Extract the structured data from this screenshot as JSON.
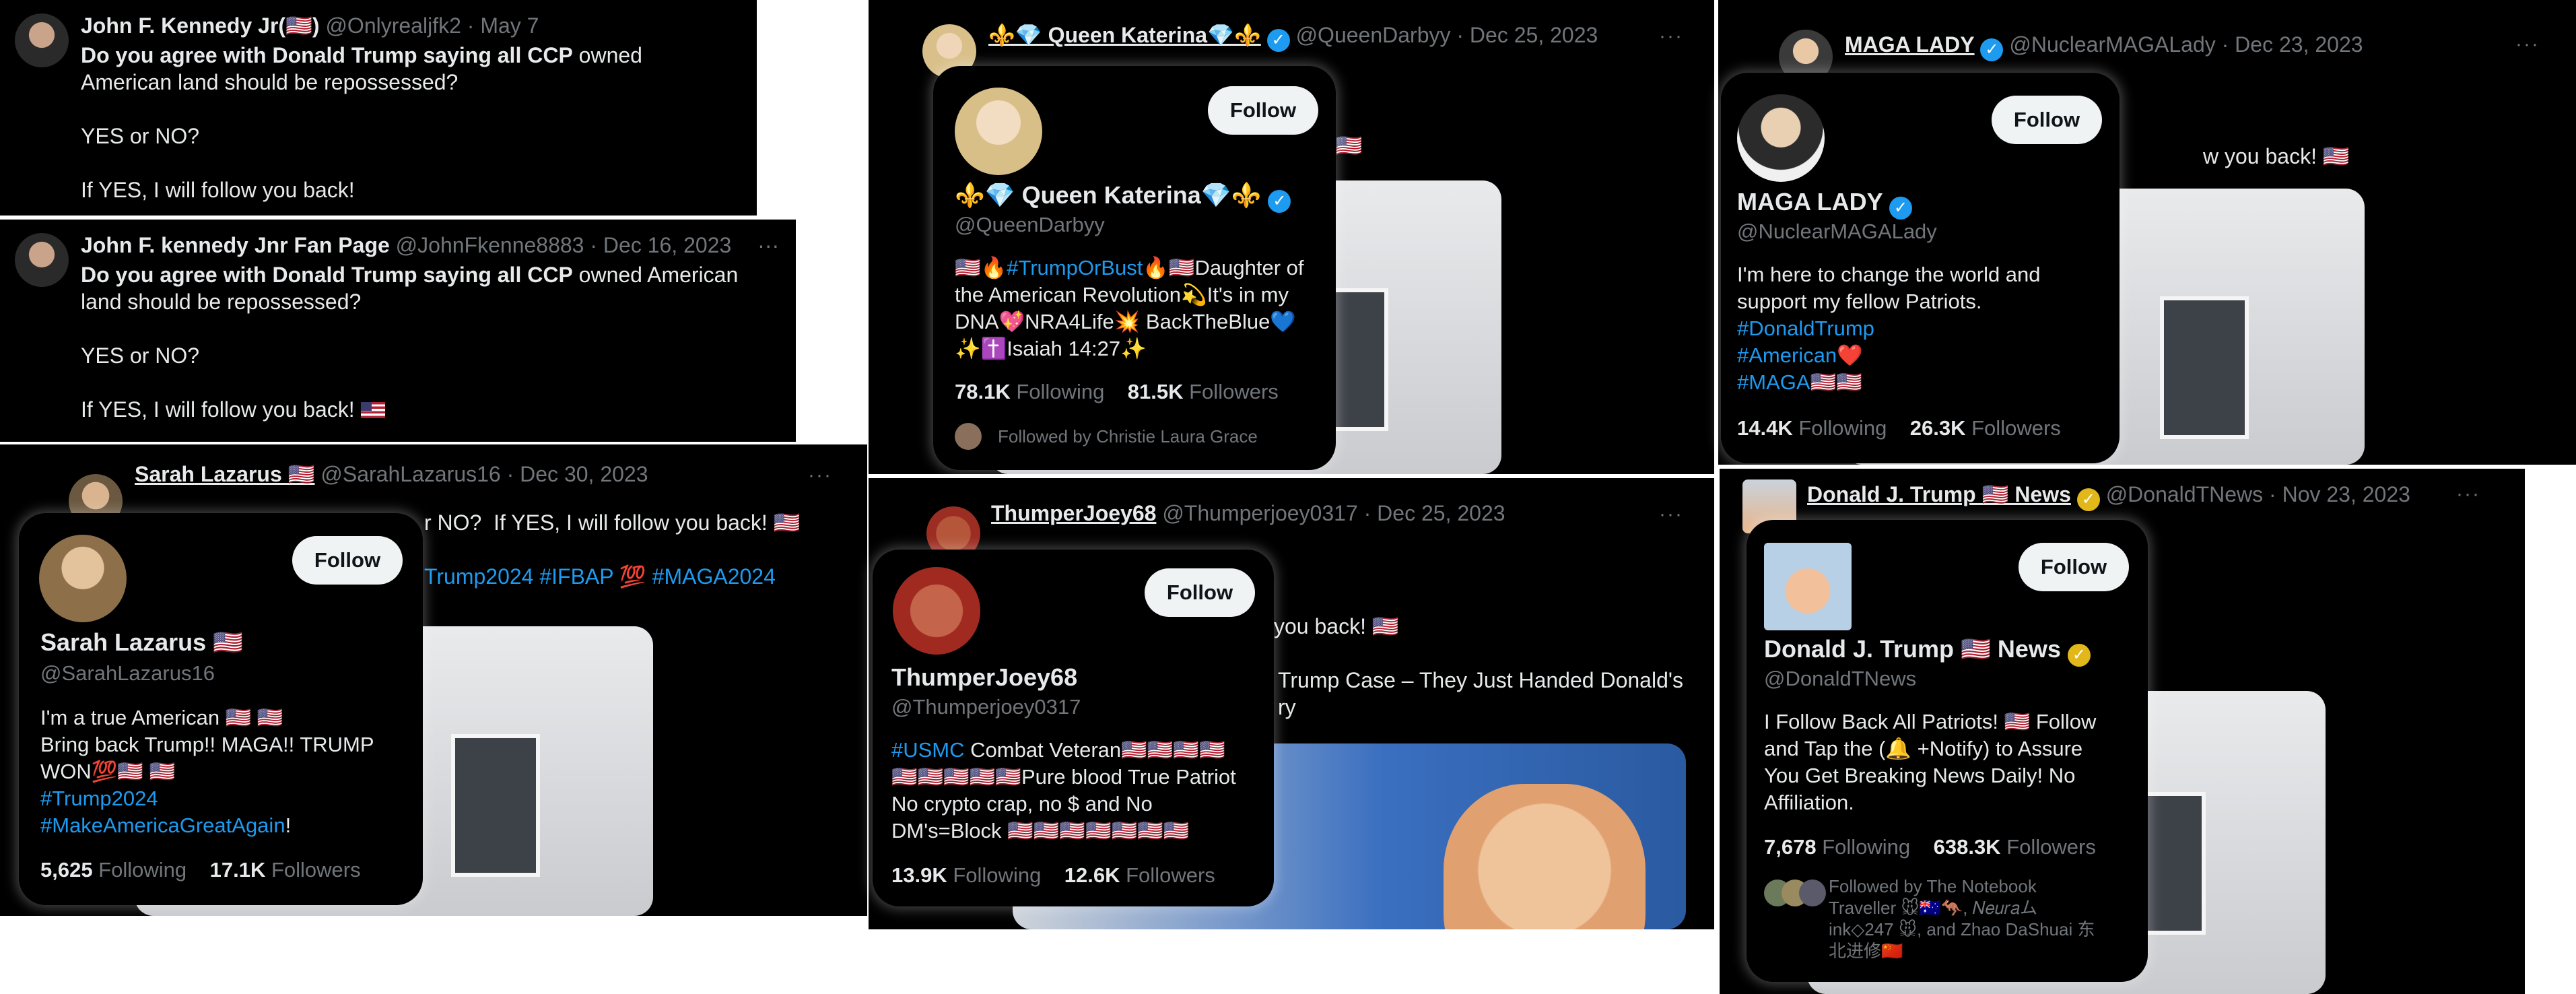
{
  "tweet_text": {
    "q_bold": "Do you agree with Donald Trump saying all CCP",
    "q_rest": " owned American land should be repossessed?",
    "yes_no": "YES or NO?",
    "follow_back": "If YES, I will follow you back!"
  },
  "ui": {
    "follow": "Follow",
    "more": "···",
    "following": "Following",
    "followers": "Followers"
  },
  "jfk1": {
    "name": "John F. Kennedy Jr(🇺🇸)",
    "handle": "@Onlyrealjfk2 · May 7"
  },
  "jfk2": {
    "name": "John F. kennedy Jnr Fan Page",
    "handle": "@JohnFkenne8883 · Dec 16, 2023"
  },
  "sarah": {
    "name": "Sarah Lazarus 🇺🇸",
    "handle_date": "@SarahLazarus16 · Dec 30, 2023",
    "tweet_fragment": "r NO?  If YES, I will follow you back! 🇺🇸",
    "tweet_tags": "Trump2024 #IFBAP 💯 #MAGA2024",
    "card": {
      "name": "Sarah Lazarus 🇺🇸",
      "handle": "@SarahLazarus16",
      "bio_l1": "I'm a true American 🇺🇸 🇺🇸",
      "bio_l2": "Bring back Trump!! MAGA!! TRUMP",
      "bio_l3": "WON💯🇺🇸 🇺🇸",
      "bio_tag1": "#Trump2024",
      "bio_tag2": "#MakeAmericaGreatAgain",
      "bio_tag2_end": "!",
      "following": "5,625",
      "followers": "17.1K"
    }
  },
  "katerina": {
    "name": "⚜️💎 Queen Katerina💎⚜️",
    "handle_date": "@QueenDarbyy · Dec 25, 2023",
    "tweet_fragment": "k! 🇺🇸",
    "card": {
      "name": "⚜️💎 Queen Katerina💎⚜️",
      "handle": "@QueenDarbyy",
      "bio_l1a": "🇺🇸🔥",
      "bio_tag": "#TrumpOrBust",
      "bio_l1b": "🔥🇺🇸Daughter of",
      "bio_l2": "the American Revolution💫It's in my",
      "bio_l3": "DNA💖NRA4Life💥 BackTheBlue💙",
      "bio_l4": "✨✝️Isaiah 14:27✨",
      "following": "78.1K",
      "followers": "81.5K",
      "followed_by": "Followed by Christie Laura Grace"
    }
  },
  "thumper": {
    "name": "ThumperJoey68",
    "handle_date": "@Thumperjoey0317 · Dec 25, 2023",
    "tweet_fragment": "you back! 🇺🇸",
    "link_l1": "Trump Case – They Just Handed Donald's",
    "link_l2": "ry",
    "card": {
      "name": "ThumperJoey68",
      "handle": "@Thumperjoey0317",
      "bio_tag": "#USMC",
      "bio_l1": " Combat Veteran🇺🇸🇺🇸🇺🇸🇺🇸",
      "bio_l2": "🇺🇸🇺🇸🇺🇸🇺🇸🇺🇸Pure blood True Patriot",
      "bio_l3": "No crypto crap, no $ and No",
      "bio_l4": "DM's=Block 🇺🇸🇺🇸🇺🇸🇺🇸🇺🇸🇺🇸🇺🇸",
      "following": "13.9K",
      "followers": "12.6K"
    }
  },
  "maga": {
    "name": "MAGA LADY",
    "handle_date": "@NuclearMAGALady · Dec 23, 2023",
    "tweet_fragment": "w you back! 🇺🇸",
    "card": {
      "name": "MAGA LADY",
      "handle": "@NuclearMAGALady",
      "bio_l1": "I'm here to change the world and",
      "bio_l2": "support my fellow Patriots.",
      "bio_tag1": "#DonaldTrump",
      "bio_tag2": "#American",
      "bio_tag2_end": "❤️",
      "bio_tag3": "#MAGA",
      "bio_tag3_end": "🇺🇸🇺🇸",
      "following": "14.4K",
      "followers": "26.3K"
    }
  },
  "djt": {
    "name": "Donald J. Trump 🇺🇸 News",
    "handle_date": "@DonaldTNews · Nov 23, 2023",
    "card": {
      "name": "Donald J. Trump 🇺🇸 News",
      "handle": "@DonaldTNews",
      "bio_l1": "I Follow Back All Patriots! 🇺🇸 Follow",
      "bio_l2": "and Tap the (🔔 +Notify) to Assure",
      "bio_l3": "You Get Breaking News Daily! No",
      "bio_l4": "Affiliation.",
      "following": "7,678",
      "followers": "638.3K",
      "fb_l1": "Followed by The Notebook",
      "fb_l2": "Traveller 🐭🇦🇺🦘, 𝑁𝑒𝑢𝑟𝑎ム",
      "fb_l3": "ink◇247 🐭, and Zhao DaShuai 东",
      "fb_l4": "北进修🇨🇳"
    }
  }
}
